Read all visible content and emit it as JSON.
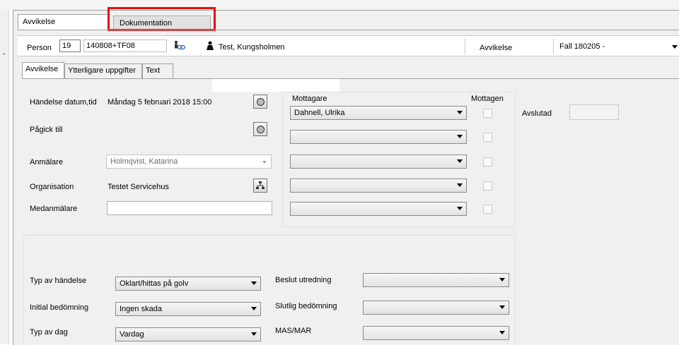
{
  "tabs": {
    "avvikelse": "Avvikelse",
    "dokumentation": "Dokumentation"
  },
  "person": {
    "label": "Person",
    "prefix": "19",
    "number": "140808+TF08",
    "name": "Test, Kungsholmen",
    "avvikelse_label": "Avvikelse",
    "avvikelse_value": "Fall 180205 -"
  },
  "subtabs": {
    "avvikelse": "Avvikelse",
    "ytterligare": "Ytterligare uppgifter",
    "text": "Text"
  },
  "form": {
    "handelse_label": "Händelse datum,tid",
    "handelse_value": "Måndag 5 februari 2018 15:00",
    "pagick_label": "Pågick till",
    "anmalare_label": "Anmälare",
    "anmalare_value": "Holmqvist, Katarina",
    "organisation_label": "Organisation",
    "organisation_value": "Testet Servicehus",
    "medanmalare_label": "Medanmälare",
    "medanmalare_value": ""
  },
  "mottagare": {
    "header": "Mottagare",
    "mottagen_header": "Mottagen",
    "rows": [
      "Dahnell, Ulrika",
      "",
      "",
      "",
      ""
    ],
    "avslutad_label": "Avslutad",
    "avslutad_value": ""
  },
  "lower": {
    "typ_label": "Typ av händelse",
    "typ_value": "Oklart/hittas på golv",
    "initial_label": "Initial bedömning",
    "initial_value": "Ingen skada",
    "typdag_label": "Typ av dag",
    "typdag_value": "Vardag",
    "beslut_label": "Beslut utredning",
    "beslut_value": "",
    "slutlig_label": "Slutlig bedömning",
    "slutlig_value": "",
    "masmar_label": "MAS/MAR",
    "masmar_value": ""
  },
  "colors": {
    "highlight": "#e01010",
    "window_bg": "#f0f0f0"
  }
}
